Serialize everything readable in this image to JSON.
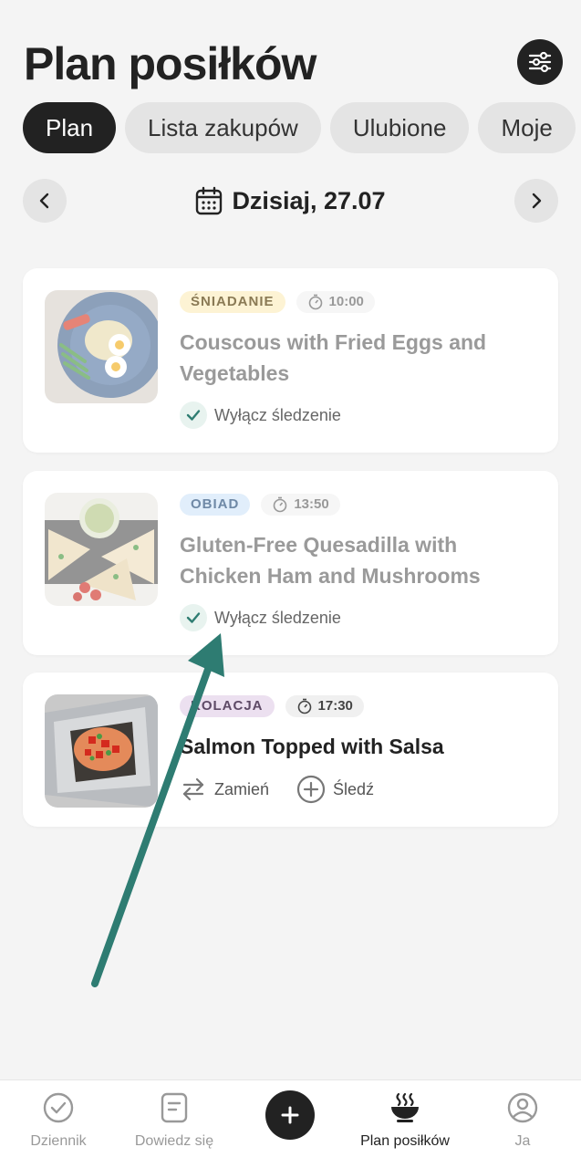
{
  "header": {
    "title": "Plan posiłków"
  },
  "tabs": [
    {
      "label": "Plan",
      "active": true
    },
    {
      "label": "Lista zakupów",
      "active": false
    },
    {
      "label": "Ulubione",
      "active": false
    },
    {
      "label": "Moje",
      "active": false
    }
  ],
  "date": {
    "label": "Dzisiaj, 27.07"
  },
  "meals": [
    {
      "badge": "ŚNIADANIE",
      "badge_bg": "#fdf3d4",
      "badge_color": "#8a7a55",
      "time": "10:00",
      "title": "Couscous with Fried Eggs and Vegetables",
      "action": "Wyłącz śledzenie"
    },
    {
      "badge": "OBIAD",
      "badge_bg": "#e1eefb",
      "badge_color": "#6f89a6",
      "time": "13:50",
      "title": "Gluten-Free Quesadilla with Chicken Ham and Mushrooms",
      "action": "Wyłącz śledzenie"
    },
    {
      "badge": "KOLACJA",
      "badge_bg": "#ece0f0",
      "badge_color": "#5e4a66",
      "time": "17:30",
      "title": "Salmon Topped with Salsa",
      "actions": {
        "swap": "Zamień",
        "track": "Śledź"
      }
    }
  ],
  "bottom_nav": {
    "journal": "Dziennik",
    "learn": "Dowiedz się",
    "plan": "Plan posiłków",
    "me": "Ja"
  },
  "colors": {
    "accent": "#2f7d72",
    "dark": "#222222",
    "arrow": "#2e7c72"
  }
}
